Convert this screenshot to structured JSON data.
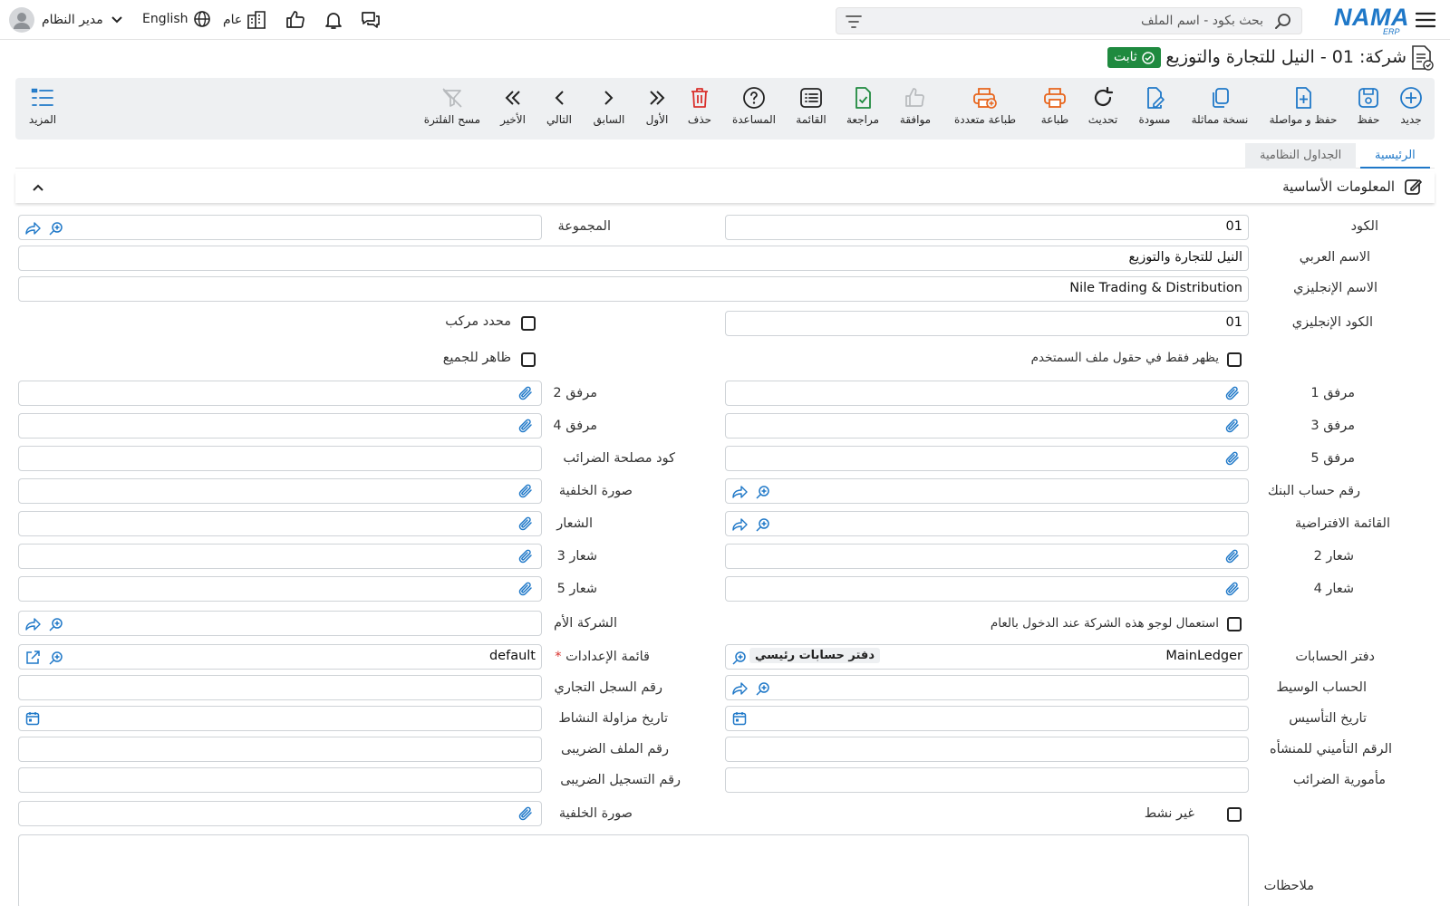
{
  "topbar": {
    "search_placeholder": "بحث بكود - اسم الملف",
    "language": "English",
    "branch": "عام",
    "user": "مدير النظام"
  },
  "logo": {
    "word": "NAMA",
    "sub": "ERP"
  },
  "page": {
    "title": "شركة: 01 - النيل للتجارة والتوزيع",
    "status": "ثابت"
  },
  "toolbar": {
    "new": "جديد",
    "save": "حفظ",
    "save_continue": "حفظ و مواصلة",
    "duplicate": "نسخة مماثلة",
    "draft": "مسودة",
    "refresh": "تحديث",
    "print": "طباعة",
    "multi_print": "طباعة متعددة",
    "approve": "موافقة",
    "review": "مراجعة",
    "list": "القائمة",
    "help": "المساعدة",
    "delete": "حذف",
    "first": "الأول",
    "previous": "السابق",
    "next": "التالي",
    "last": "الأخير",
    "clear_filter": "مسح الفلترة",
    "more": "المزيد"
  },
  "tabs": {
    "main": "الرئيسية",
    "system_tables": "الجداول النظامية"
  },
  "section": {
    "basic_info": "المعلومات الأساسية"
  },
  "form": {
    "code": {
      "label": "الكود",
      "value": "01"
    },
    "group": {
      "label": "المجموعة",
      "value": ""
    },
    "arabic_name": {
      "label": "الاسم العربي",
      "value": "النيل للتجارة والتوزيع"
    },
    "english_name": {
      "label": "الاسم الإنجليزي",
      "value": "Nile Trading & Distribution"
    },
    "english_code": {
      "label": "الكود الإنجليزي",
      "value": "01"
    },
    "composite_id": {
      "label": "محدد مركب"
    },
    "visible_all": {
      "label": "ظاهر للجميع"
    },
    "user_file_only": {
      "label": "يظهر فقط في حقول ملف السمتخدم"
    },
    "attach1": {
      "label": "مرفق 1"
    },
    "attach2": {
      "label": "مرفق 2"
    },
    "attach3": {
      "label": "مرفق 3"
    },
    "attach4": {
      "label": "مرفق 4"
    },
    "attach5": {
      "label": "مرفق 5"
    },
    "tax_authority_code": {
      "label": "كود مصلحة الضرائب"
    },
    "bank_account": {
      "label": "رقم حساب البنك"
    },
    "background_image": {
      "label": "صورة الخلفية"
    },
    "default_list": {
      "label": "القائمة الافتراضية"
    },
    "logo_field": {
      "label": "الشعار"
    },
    "logo2": {
      "label": "شعار 2"
    },
    "logo3": {
      "label": "شعار 3"
    },
    "logo4": {
      "label": "شعار 4"
    },
    "logo5": {
      "label": "شعار 5"
    },
    "use_logo_login": {
      "label": "استعمال لوجو هذه الشركة عند الدخول بالعام"
    },
    "parent_company": {
      "label": "الشركة الأم"
    },
    "ledger": {
      "label": "دفتر الحسابات",
      "value": "MainLedger",
      "tag": "دفتر حسابات رئيسي"
    },
    "settings_list": {
      "label": "قائمة الإعدادات",
      "value": "default",
      "required": "*"
    },
    "intermediate_account": {
      "label": "الحساب الوسيط"
    },
    "commercial_register": {
      "label": "رقم السجل التجاري"
    },
    "founding_date": {
      "label": "تاريخ التأسيس"
    },
    "activity_start_date": {
      "label": "تاريخ مزاولة النشاط"
    },
    "insurance_number": {
      "label": "الرقم التأميني للمنشأه"
    },
    "tax_file_number": {
      "label": "رقم الملف الضريبى"
    },
    "tax_office": {
      "label": "مأمورية الضرائب"
    },
    "tax_registration": {
      "label": "رقم التسجيل الضريبى"
    },
    "inactive": {
      "label": "غير نشط"
    },
    "background_image2": {
      "label": "صورة الخلفية"
    },
    "notes": {
      "label": "ملاحظات"
    }
  },
  "colors": {
    "accent": "#1f78c8",
    "green": "#1f8a3f",
    "orange": "#e8641b",
    "danger": "#d9302c"
  }
}
